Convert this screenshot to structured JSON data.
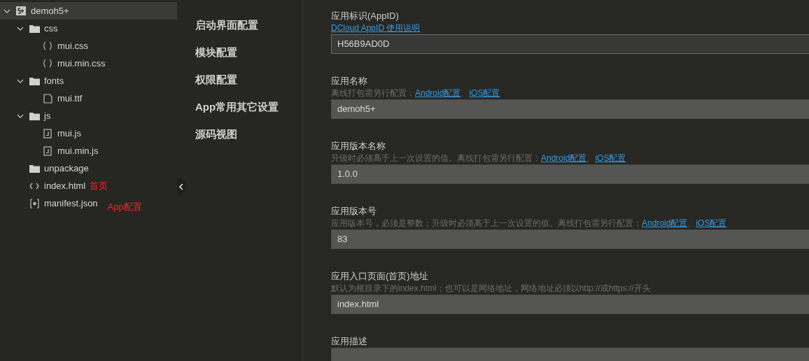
{
  "tree": [
    {
      "label": "demoh5+",
      "kind": "project",
      "expanded": true,
      "selected": true,
      "children": [
        {
          "label": "css",
          "kind": "folder",
          "expanded": true,
          "selected": false,
          "children": [
            {
              "label": "mui.css",
              "kind": "css",
              "selected": false
            },
            {
              "label": "mui.min.css",
              "kind": "css",
              "selected": false
            }
          ]
        },
        {
          "label": "fonts",
          "kind": "folder",
          "expanded": true,
          "selected": false,
          "children": [
            {
              "label": "mui.ttf",
              "kind": "file",
              "selected": false
            }
          ]
        },
        {
          "label": "js",
          "kind": "folder",
          "expanded": true,
          "selected": false,
          "children": [
            {
              "label": "mui.js",
              "kind": "js",
              "selected": false
            },
            {
              "label": "mui.min.js",
              "kind": "js",
              "selected": false
            }
          ]
        },
        {
          "label": "unpackage",
          "kind": "folder",
          "selected": false
        },
        {
          "label": "index.html",
          "kind": "html",
          "selected": false,
          "note": "首页"
        },
        {
          "label": "manifest.json",
          "kind": "manifest",
          "selected": false,
          "note": "App配置"
        }
      ]
    }
  ],
  "nav": [
    {
      "label": "启动界面配置",
      "selected": false
    },
    {
      "label": "模块配置",
      "selected": false
    },
    {
      "label": "权限配置",
      "selected": false
    },
    {
      "label": "App常用其它设置",
      "selected": false
    },
    {
      "label": "源码视图",
      "selected": false
    }
  ],
  "fields": [
    {
      "label": "应用标识(AppID)",
      "links": [
        "DCloud AppID 使用说明"
      ],
      "value": "H56B9AD0D",
      "readonly": true
    },
    {
      "label": "应用名称",
      "hint": "离线打包需另行配置：",
      "links": [
        "Android配置",
        "iOS配置"
      ],
      "separator": "、",
      "value": "demoh5+",
      "readonly": false
    },
    {
      "label": "应用版本名称",
      "hint": "升级时必须高于上一次设置的值。离线打包需另行配置：",
      "links": [
        "Android配置",
        "iOS配置"
      ],
      "separator": "、",
      "value": "1.0.0",
      "readonly": false
    },
    {
      "label": "应用版本号",
      "hint": "应用版本号，必须是整数；升级时必须高于上一次设置的值。离线打包需另行配置：",
      "links": [
        "Android配置",
        "iOS配置"
      ],
      "separator": "、",
      "value": "83",
      "readonly": false
    },
    {
      "label": "应用入口页面(首页)地址",
      "hint": "默认为根目录下的index.html；也可以是网络地址，网络地址必须以http://或https://开头",
      "value": "index.html",
      "readonly": false
    },
    {
      "label": "应用描述",
      "readonly": false
    }
  ]
}
